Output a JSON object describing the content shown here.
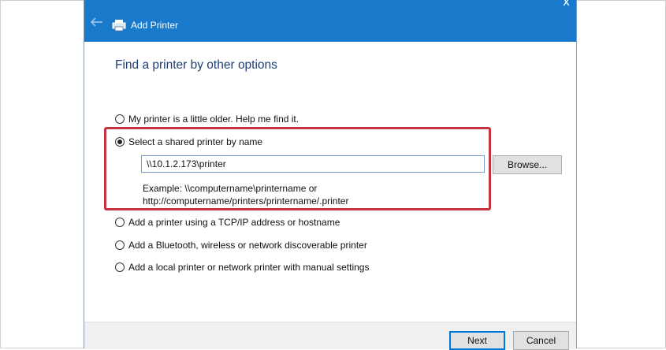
{
  "window": {
    "title": "Add Printer",
    "close_glyph": "x",
    "back_icon": "back-arrow-icon",
    "title_icon": "printer-icon"
  },
  "content": {
    "heading": "Find a printer by other options"
  },
  "options": [
    {
      "label": "My printer is a little older. Help me find it.",
      "selected": false
    },
    {
      "label": "Select a shared printer by name",
      "selected": true
    },
    {
      "label": "Add a printer using a TCP/IP address or hostname",
      "selected": false
    },
    {
      "label": "Add a Bluetooth, wireless or network discoverable printer",
      "selected": false
    },
    {
      "label": "Add a local printer or network printer with manual settings",
      "selected": false
    }
  ],
  "shared_printer": {
    "path_value": "\\\\10.1.2.173\\printer",
    "browse_label": "Browse...",
    "example_line1": "Example: \\\\computername\\printername or",
    "example_line2": "http://computername/printers/printername/.printer"
  },
  "footer": {
    "next_label": "Next",
    "cancel_label": "Cancel"
  },
  "colors": {
    "titlebar": "#1979ca",
    "heading": "#1e3d73",
    "highlight": "#c7323f",
    "footer": "#f0f0f0"
  }
}
